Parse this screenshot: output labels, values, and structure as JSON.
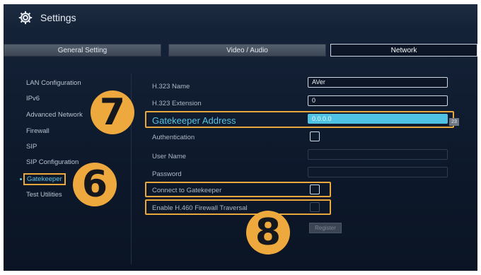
{
  "window": {
    "title": "Settings",
    "icon": "gear-icon"
  },
  "tabs": [
    {
      "label": "General Setting",
      "active": false
    },
    {
      "label": "Video / Audio",
      "active": false
    },
    {
      "label": "Network",
      "active": true
    }
  ],
  "sidebar": {
    "items": [
      {
        "label": "LAN Configuration",
        "active": false
      },
      {
        "label": "IPv6",
        "active": false
      },
      {
        "label": "Advanced Network",
        "active": false
      },
      {
        "label": "Firewall",
        "active": false
      },
      {
        "label": "SIP",
        "active": false
      },
      {
        "label": "SIP Configuration",
        "active": false
      },
      {
        "label": "Gatekeeper",
        "active": true
      },
      {
        "label": "Test Utilities",
        "active": false
      }
    ]
  },
  "form": {
    "h323_name": {
      "label": "H.323 Name",
      "value": "AVer"
    },
    "h323_extension": {
      "label": "H.323 Extension",
      "value": "0"
    },
    "gatekeeper_address": {
      "label": "Gatekeeper Address",
      "value": "0.0.0.0",
      "suffix": "23"
    },
    "authentication": {
      "label": "Authentication",
      "checked": false
    },
    "user_name": {
      "label": "User Name",
      "value": ""
    },
    "password": {
      "label": "Password",
      "value": ""
    },
    "connect_gatekeeper": {
      "label": "Connect to Gatekeeper",
      "checked": false
    },
    "enable_h460": {
      "label": "Enable H.460 Firewall Traversal",
      "checked": false
    },
    "register_label": "Register"
  },
  "callouts": {
    "badge_6": "6",
    "badge_7": "7",
    "badge_8": "8"
  },
  "colors": {
    "highlight": "#e9a83c",
    "accent": "#5fc6e8",
    "background": "#0e1a2d"
  }
}
